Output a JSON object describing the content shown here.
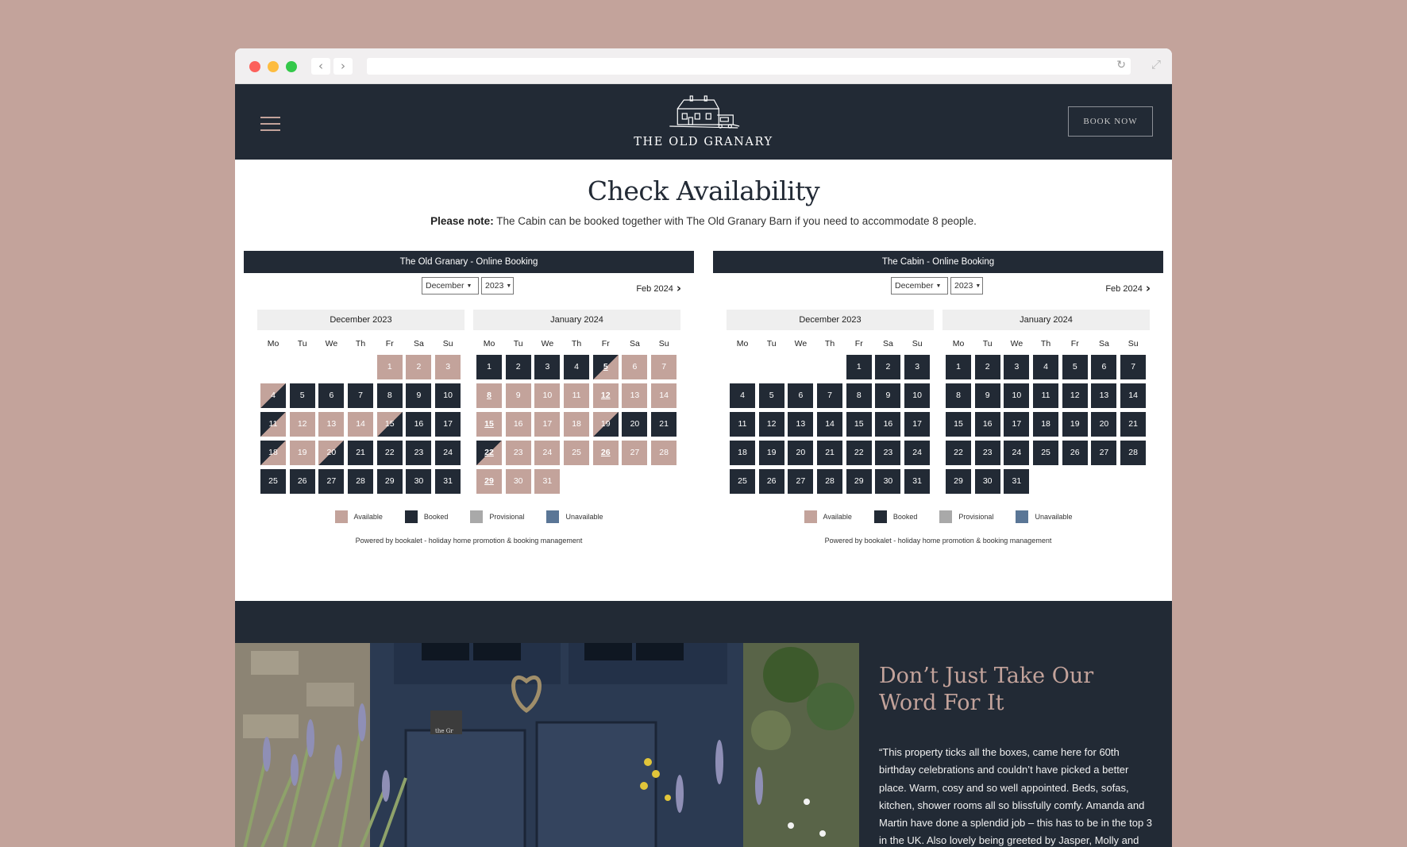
{
  "browser": {
    "back_icon": "chevron-left-icon",
    "forward_icon": "chevron-right-icon",
    "reload_icon": "reload-icon",
    "expand_icon": "expand-icon"
  },
  "header": {
    "logo_text": "THE OLD GRANARY",
    "book_now": "BOOK NOW",
    "menu_icon": "hamburger-menu-icon"
  },
  "availability": {
    "title": "Check Availability",
    "note_bold": "Please note:",
    "note_text": "The Cabin can be booked together with The Old Granary Barn if you need to accommodate 8 people."
  },
  "day_labels": [
    "Mo",
    "Tu",
    "We",
    "Th",
    "Fr",
    "Sa",
    "Su"
  ],
  "legend": [
    {
      "label": "Available",
      "color": "#c3a39b"
    },
    {
      "label": "Booked",
      "color": "#222a35"
    },
    {
      "label": "Provisional",
      "color": "#a9a9a9"
    },
    {
      "label": "Unavailable",
      "color": "#5a7696"
    }
  ],
  "widgets": [
    {
      "title": "The Old Granary - Online Booking",
      "month_select": "December",
      "year_select": "2023",
      "next_label": "Feb 2024",
      "powered_by": "Powered by bookalet - holiday home promotion & booking management",
      "calendars": [
        {
          "heading": "December 2023",
          "offset": 4,
          "days": [
            {
              "d": "1",
              "s": "av"
            },
            {
              "d": "2",
              "s": "av"
            },
            {
              "d": "3",
              "s": "av"
            },
            {
              "d": "4",
              "s": "split-b"
            },
            {
              "d": "5",
              "s": "bk"
            },
            {
              "d": "6",
              "s": "bk"
            },
            {
              "d": "7",
              "s": "bk"
            },
            {
              "d": "8",
              "s": "bk"
            },
            {
              "d": "9",
              "s": "bk"
            },
            {
              "d": "10",
              "s": "bk"
            },
            {
              "d": "11",
              "s": "split-a"
            },
            {
              "d": "12",
              "s": "av"
            },
            {
              "d": "13",
              "s": "av"
            },
            {
              "d": "14",
              "s": "av"
            },
            {
              "d": "15",
              "s": "split-b"
            },
            {
              "d": "16",
              "s": "bk"
            },
            {
              "d": "17",
              "s": "bk"
            },
            {
              "d": "18",
              "s": "split-a"
            },
            {
              "d": "19",
              "s": "av"
            },
            {
              "d": "20",
              "s": "split-b"
            },
            {
              "d": "21",
              "s": "bk"
            },
            {
              "d": "22",
              "s": "bk"
            },
            {
              "d": "23",
              "s": "bk"
            },
            {
              "d": "24",
              "s": "bk"
            },
            {
              "d": "25",
              "s": "bk"
            },
            {
              "d": "26",
              "s": "bk"
            },
            {
              "d": "27",
              "s": "bk"
            },
            {
              "d": "28",
              "s": "bk"
            },
            {
              "d": "29",
              "s": "bk"
            },
            {
              "d": "30",
              "s": "bk"
            },
            {
              "d": "31",
              "s": "bk"
            }
          ]
        },
        {
          "heading": "January 2024",
          "offset": 0,
          "days": [
            {
              "d": "1",
              "s": "bk"
            },
            {
              "d": "2",
              "s": "bk"
            },
            {
              "d": "3",
              "s": "bk"
            },
            {
              "d": "4",
              "s": "bk"
            },
            {
              "d": "5",
              "s": "split-a",
              "u": true
            },
            {
              "d": "6",
              "s": "av"
            },
            {
              "d": "7",
              "s": "av"
            },
            {
              "d": "8",
              "s": "av",
              "u": true
            },
            {
              "d": "9",
              "s": "av"
            },
            {
              "d": "10",
              "s": "av"
            },
            {
              "d": "11",
              "s": "av"
            },
            {
              "d": "12",
              "s": "av",
              "u": true
            },
            {
              "d": "13",
              "s": "av"
            },
            {
              "d": "14",
              "s": "av"
            },
            {
              "d": "15",
              "s": "av",
              "u": true
            },
            {
              "d": "16",
              "s": "av"
            },
            {
              "d": "17",
              "s": "av"
            },
            {
              "d": "18",
              "s": "av"
            },
            {
              "d": "19",
              "s": "split-b"
            },
            {
              "d": "20",
              "s": "bk"
            },
            {
              "d": "21",
              "s": "bk"
            },
            {
              "d": "22",
              "s": "split-a",
              "u": true
            },
            {
              "d": "23",
              "s": "av"
            },
            {
              "d": "24",
              "s": "av"
            },
            {
              "d": "25",
              "s": "av"
            },
            {
              "d": "26",
              "s": "av",
              "u": true
            },
            {
              "d": "27",
              "s": "av"
            },
            {
              "d": "28",
              "s": "av"
            },
            {
              "d": "29",
              "s": "av",
              "u": true
            },
            {
              "d": "30",
              "s": "av"
            },
            {
              "d": "31",
              "s": "av"
            }
          ]
        }
      ]
    },
    {
      "title": "The Cabin - Online Booking",
      "month_select": "December",
      "year_select": "2023",
      "next_label": "Feb 2024",
      "powered_by": "Powered by bookalet - holiday home promotion & booking management",
      "calendars": [
        {
          "heading": "December 2023",
          "offset": 4,
          "days": [
            {
              "d": "1",
              "s": "bk"
            },
            {
              "d": "2",
              "s": "bk"
            },
            {
              "d": "3",
              "s": "bk"
            },
            {
              "d": "4",
              "s": "bk"
            },
            {
              "d": "5",
              "s": "bk"
            },
            {
              "d": "6",
              "s": "bk"
            },
            {
              "d": "7",
              "s": "bk"
            },
            {
              "d": "8",
              "s": "bk"
            },
            {
              "d": "9",
              "s": "bk"
            },
            {
              "d": "10",
              "s": "bk"
            },
            {
              "d": "11",
              "s": "bk"
            },
            {
              "d": "12",
              "s": "bk"
            },
            {
              "d": "13",
              "s": "bk"
            },
            {
              "d": "14",
              "s": "bk"
            },
            {
              "d": "15",
              "s": "bk"
            },
            {
              "d": "16",
              "s": "bk"
            },
            {
              "d": "17",
              "s": "bk"
            },
            {
              "d": "18",
              "s": "bk"
            },
            {
              "d": "19",
              "s": "bk"
            },
            {
              "d": "20",
              "s": "bk"
            },
            {
              "d": "21",
              "s": "bk"
            },
            {
              "d": "22",
              "s": "bk"
            },
            {
              "d": "23",
              "s": "bk"
            },
            {
              "d": "24",
              "s": "bk"
            },
            {
              "d": "25",
              "s": "bk"
            },
            {
              "d": "26",
              "s": "bk"
            },
            {
              "d": "27",
              "s": "bk"
            },
            {
              "d": "28",
              "s": "bk"
            },
            {
              "d": "29",
              "s": "bk"
            },
            {
              "d": "30",
              "s": "bk"
            },
            {
              "d": "31",
              "s": "bk"
            }
          ]
        },
        {
          "heading": "January 2024",
          "offset": 0,
          "days": [
            {
              "d": "1",
              "s": "bk"
            },
            {
              "d": "2",
              "s": "bk"
            },
            {
              "d": "3",
              "s": "bk"
            },
            {
              "d": "4",
              "s": "bk"
            },
            {
              "d": "5",
              "s": "bk"
            },
            {
              "d": "6",
              "s": "bk"
            },
            {
              "d": "7",
              "s": "bk"
            },
            {
              "d": "8",
              "s": "bk"
            },
            {
              "d": "9",
              "s": "bk"
            },
            {
              "d": "10",
              "s": "bk"
            },
            {
              "d": "11",
              "s": "bk"
            },
            {
              "d": "12",
              "s": "bk"
            },
            {
              "d": "13",
              "s": "bk"
            },
            {
              "d": "14",
              "s": "bk"
            },
            {
              "d": "15",
              "s": "bk"
            },
            {
              "d": "16",
              "s": "bk"
            },
            {
              "d": "17",
              "s": "bk"
            },
            {
              "d": "18",
              "s": "bk"
            },
            {
              "d": "19",
              "s": "bk"
            },
            {
              "d": "20",
              "s": "bk"
            },
            {
              "d": "21",
              "s": "bk"
            },
            {
              "d": "22",
              "s": "bk"
            },
            {
              "d": "23",
              "s": "bk"
            },
            {
              "d": "24",
              "s": "bk"
            },
            {
              "d": "25",
              "s": "bk"
            },
            {
              "d": "26",
              "s": "bk"
            },
            {
              "d": "27",
              "s": "bk"
            },
            {
              "d": "28",
              "s": "bk"
            },
            {
              "d": "29",
              "s": "bk"
            },
            {
              "d": "30",
              "s": "bk"
            },
            {
              "d": "31",
              "s": "bk"
            }
          ]
        }
      ]
    }
  ],
  "reviews": {
    "title": "Don’t Just Take Our Word For It",
    "quote": "“This property ticks all the boxes, came here for 60th birthday celebrations and couldn’t have picked a better place. Warm, cosy and so well appointed. Beds, sofas, kitchen, shower rooms all so blissfully comfy. Amanda and Martin have done a splendid job – this has to be in the top 3 in the UK. Also lovely being greeted by Jasper, Molly and",
    "door_sign": "the Gr"
  }
}
